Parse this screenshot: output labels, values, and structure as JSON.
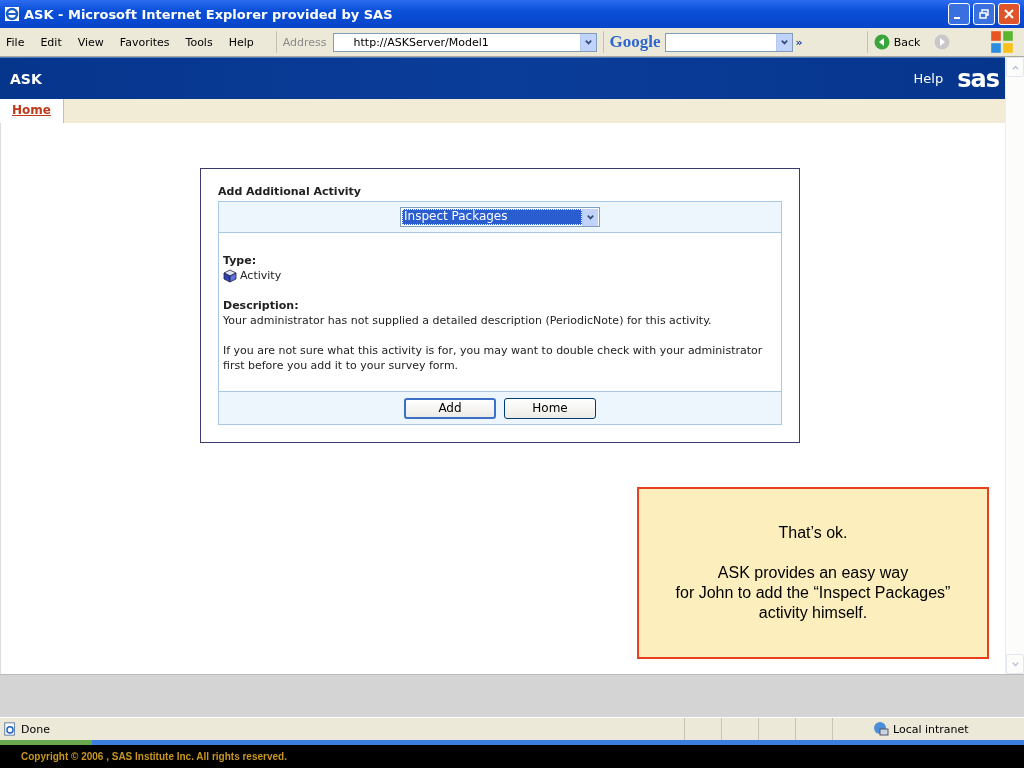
{
  "window": {
    "title": "ASK - Microsoft Internet Explorer provided by SAS"
  },
  "menu": [
    "File",
    "Edit",
    "View",
    "Favorites",
    "Tools",
    "Help"
  ],
  "address": {
    "label": "Address",
    "value": "http://ASKServer/Model1"
  },
  "google": {
    "label": "Google",
    "chevron": "»"
  },
  "nav": {
    "back": "Back"
  },
  "banner": {
    "title": "ASK",
    "help": "Help",
    "logo": "sas"
  },
  "tabs": [
    {
      "label": "Home",
      "selected": true
    }
  ],
  "form": {
    "heading": "Add Additional Activity",
    "activity": "Inspect Packages",
    "type_label": "Type:",
    "type_value": "Activity",
    "description_label": "Description:",
    "description": "Your administrator has not supplied a detailed description (PeriodicNote) for this activity.",
    "note": "If you are not sure what this activity is for, you may want to double check with your administrator first before you add it to your survey form.",
    "buttons": [
      "Add",
      "Home"
    ]
  },
  "callout": {
    "paragraphs": [
      [
        "That’s ok."
      ],
      [
        "ASK provides an easy way",
        "for John to add the “Inspect Packages”",
        "activity himself."
      ]
    ]
  },
  "status_bar": {
    "status": "Done",
    "zone": "Local intranet"
  },
  "footer": {
    "copyright": "Copyright © 2006 , SAS Institute Inc. All rights reserved."
  }
}
